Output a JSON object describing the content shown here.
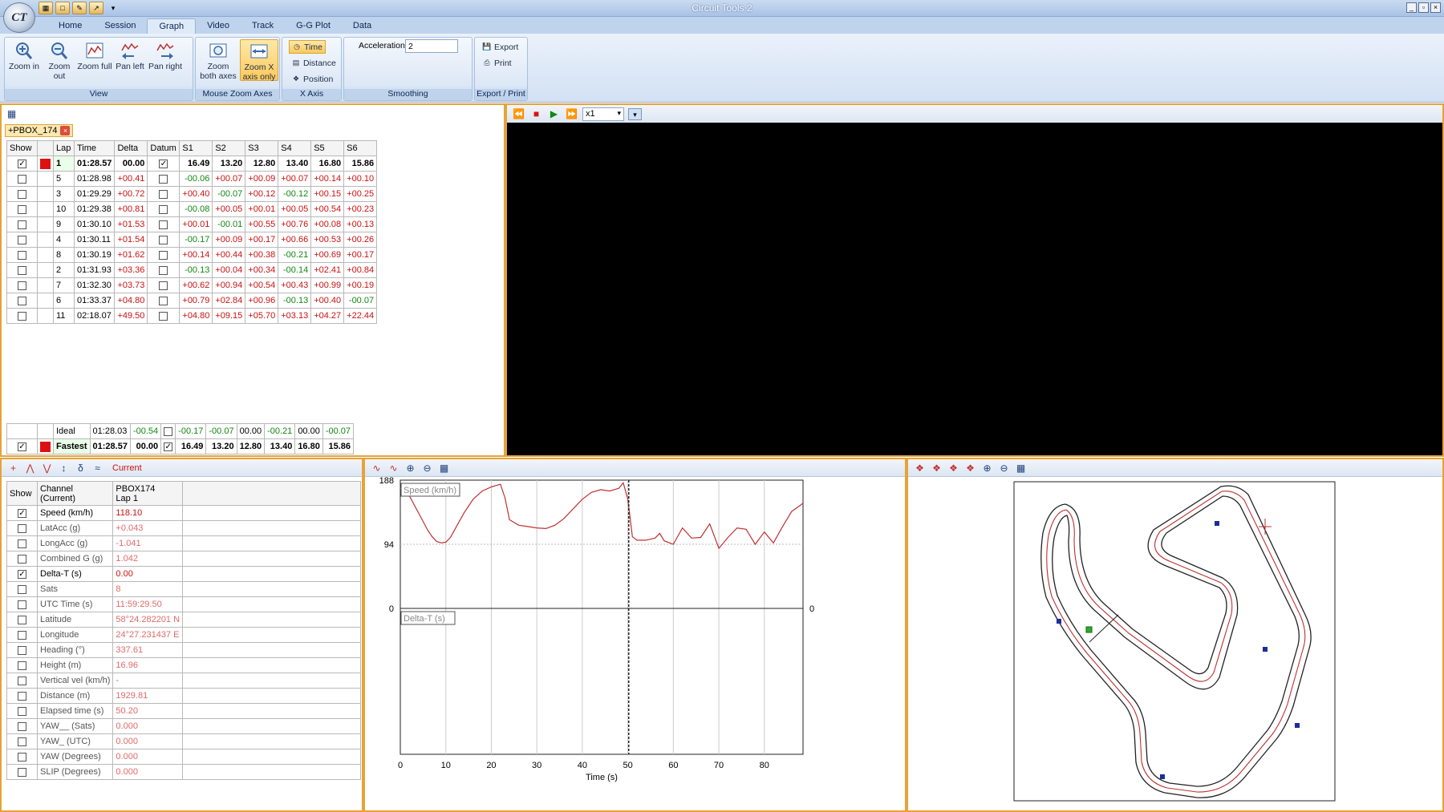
{
  "app": {
    "title": "Circuit Tools 2",
    "logo": "CT"
  },
  "tabs": [
    "Home",
    "Session",
    "Graph",
    "Video",
    "Track",
    "G-G Plot",
    "Data"
  ],
  "active_tab": "Graph",
  "ribbon": {
    "view": {
      "label": "View",
      "buttons": [
        {
          "label": "Zoom in",
          "icon": "zoom-in-icon"
        },
        {
          "label": "Zoom out",
          "icon": "zoom-out-icon"
        },
        {
          "label": "Zoom full",
          "icon": "zoom-full-icon"
        },
        {
          "label": "Pan left",
          "icon": "pan-left-icon"
        },
        {
          "label": "Pan right",
          "icon": "pan-right-icon"
        }
      ]
    },
    "mouse_zoom": {
      "label": "Mouse Zoom Axes",
      "buttons": [
        {
          "label": "Zoom both axes"
        },
        {
          "label": "Zoom X axis only",
          "selected": true
        }
      ]
    },
    "x_axis": {
      "label": "X Axis",
      "options": [
        "Time",
        "Distance",
        "Position"
      ],
      "selected": "Time"
    },
    "smoothing": {
      "label": "Smoothing",
      "field_label": "Acceleration",
      "value": "2"
    },
    "export": {
      "label": "Export / Print",
      "buttons": [
        "Export",
        "Print"
      ]
    }
  },
  "session_tab": "+PBOX_174",
  "laps": {
    "headers": [
      "Show",
      "",
      "Lap",
      "Time",
      "Delta",
      "Datum",
      "S1",
      "S2",
      "S3",
      "S4",
      "S5",
      "S6"
    ],
    "rows": [
      {
        "show": true,
        "color": "#dd1111",
        "lap": "1",
        "time": "01:28.57",
        "delta": "00.00",
        "datum": true,
        "s": [
          "16.49",
          "13.20",
          "12.80",
          "13.40",
          "16.80",
          "15.86"
        ],
        "bold": true
      },
      {
        "show": false,
        "lap": "5",
        "time": "01:28.98",
        "delta": "+00.41",
        "datum": false,
        "s": [
          "-00.06",
          "+00.07",
          "+00.09",
          "+00.07",
          "+00.14",
          "+00.10"
        ]
      },
      {
        "show": false,
        "lap": "3",
        "time": "01:29.29",
        "delta": "+00.72",
        "datum": false,
        "s": [
          "+00.40",
          "-00.07",
          "+00.12",
          "-00.12",
          "+00.15",
          "+00.25"
        ]
      },
      {
        "show": false,
        "lap": "10",
        "time": "01:29.38",
        "delta": "+00.81",
        "datum": false,
        "s": [
          "-00.08",
          "+00.05",
          "+00.01",
          "+00.05",
          "+00.54",
          "+00.23"
        ]
      },
      {
        "show": false,
        "lap": "9",
        "time": "01:30.10",
        "delta": "+01.53",
        "datum": false,
        "s": [
          "+00.01",
          "-00.01",
          "+00.55",
          "+00.76",
          "+00.08",
          "+00.13"
        ]
      },
      {
        "show": false,
        "lap": "4",
        "time": "01:30.11",
        "delta": "+01.54",
        "datum": false,
        "s": [
          "-00.17",
          "+00.09",
          "+00.17",
          "+00.66",
          "+00.53",
          "+00.26"
        ]
      },
      {
        "show": false,
        "lap": "8",
        "time": "01:30.19",
        "delta": "+01.62",
        "datum": false,
        "s": [
          "+00.14",
          "+00.44",
          "+00.38",
          "-00.21",
          "+00.69",
          "+00.17"
        ]
      },
      {
        "show": false,
        "lap": "2",
        "time": "01:31.93",
        "delta": "+03.36",
        "datum": false,
        "s": [
          "-00.13",
          "+00.04",
          "+00.34",
          "-00.14",
          "+02.41",
          "+00.84"
        ]
      },
      {
        "show": false,
        "lap": "7",
        "time": "01:32.30",
        "delta": "+03.73",
        "datum": false,
        "s": [
          "+00.62",
          "+00.94",
          "+00.54",
          "+00.43",
          "+00.99",
          "+00.19"
        ]
      },
      {
        "show": false,
        "lap": "6",
        "time": "01:33.37",
        "delta": "+04.80",
        "datum": false,
        "s": [
          "+00.79",
          "+02.84",
          "+00.96",
          "-00.13",
          "+00.40",
          "-00.07"
        ]
      },
      {
        "show": false,
        "lap": "11",
        "time": "02:18.07",
        "delta": "+49.50",
        "datum": false,
        "s": [
          "+04.80",
          "+09.15",
          "+05.70",
          "+03.13",
          "+04.27",
          "+22.44"
        ]
      }
    ],
    "summary": [
      {
        "show": null,
        "lap": "Ideal",
        "time": "01:28.03",
        "delta": "-00.54",
        "datum": false,
        "s": [
          "-00.17",
          "-00.07",
          "00.00",
          "-00.21",
          "00.00",
          "-00.07"
        ]
      },
      {
        "show": true,
        "color": "#dd1111",
        "lap": "Fastest",
        "time": "01:28.57",
        "delta": "00.00",
        "datum": true,
        "s": [
          "16.49",
          "13.20",
          "12.80",
          "13.40",
          "16.80",
          "15.86"
        ],
        "bold": true
      }
    ]
  },
  "video": {
    "speed": "x1"
  },
  "channels": {
    "toolbar_label": "Current",
    "headers": [
      "Show",
      "Channel (Current)",
      "PBOX174 Lap 1"
    ],
    "header_channel": [
      "Channel",
      "(Current)"
    ],
    "header_session": [
      "PBOX174",
      "Lap 1"
    ],
    "rows": [
      {
        "show": true,
        "name": "Speed (km/h)",
        "value": "118.10"
      },
      {
        "show": false,
        "name": "LatAcc (g)",
        "value": "+0.043"
      },
      {
        "show": false,
        "name": "LongAcc (g)",
        "value": "-1.041"
      },
      {
        "show": false,
        "name": "Combined G (g)",
        "value": "1.042"
      },
      {
        "show": true,
        "name": "Delta-T (s)",
        "value": "0.00"
      },
      {
        "show": false,
        "name": "Sats",
        "value": "8"
      },
      {
        "show": false,
        "name": "UTC Time (s)",
        "value": "11:59:29.50"
      },
      {
        "show": false,
        "name": "Latitude",
        "value": "58°24.282201 N"
      },
      {
        "show": false,
        "name": "Longitude",
        "value": "24°27.231437 E"
      },
      {
        "show": false,
        "name": "Heading (°)",
        "value": "337.61"
      },
      {
        "show": false,
        "name": "Height (m)",
        "value": "16.96"
      },
      {
        "show": false,
        "name": "Vertical vel (km/h)",
        "value": "-"
      },
      {
        "show": false,
        "name": "Distance (m)",
        "value": "1929.81"
      },
      {
        "show": false,
        "name": "Elapsed time (s)",
        "value": "50.20"
      },
      {
        "show": false,
        "name": "YAW__ (Sats)",
        "value": "0.000"
      },
      {
        "show": false,
        "name": "YAW_ (UTC)",
        "value": "0.000"
      },
      {
        "show": false,
        "name": "YAW (Degrees)",
        "value": "0.000"
      },
      {
        "show": false,
        "name": "SLIP (Degrees)",
        "value": "0.000"
      }
    ]
  },
  "graph": {
    "chart_data": {
      "type": "line",
      "xlabel": "Time (s)",
      "x_ticks": [
        0,
        10,
        20,
        30,
        40,
        50,
        60,
        70,
        80
      ],
      "xlim": [
        0,
        88.5
      ],
      "cursor_x": 50.2,
      "series": [
        {
          "name": "Speed (km/h)",
          "color": "#c03030",
          "ylim": [
            0,
            188
          ],
          "y_ticks": [
            188,
            94,
            0
          ],
          "x": [
            0,
            2,
            4,
            6,
            7,
            8,
            9,
            10,
            11,
            12,
            14,
            16,
            18,
            20,
            21,
            22,
            23,
            24,
            26,
            28,
            30,
            32,
            34,
            36,
            38,
            40,
            42,
            44,
            46,
            48,
            49,
            50,
            51,
            52,
            54,
            56,
            57,
            58,
            60,
            62,
            64,
            66,
            68,
            70,
            72,
            74,
            76,
            78,
            80,
            82,
            84,
            86,
            88.5
          ],
          "y": [
            176,
            165,
            140,
            115,
            105,
            98,
            96,
            97,
            104,
            116,
            140,
            160,
            172,
            178,
            180,
            182,
            162,
            130,
            122,
            120,
            118,
            117,
            122,
            132,
            146,
            160,
            170,
            174,
            172,
            176,
            184,
            160,
            105,
            100,
            100,
            103,
            110,
            99,
            94,
            118,
            103,
            104,
            124,
            88,
            104,
            118,
            116,
            94,
            112,
            96,
            120,
            142,
            154
          ]
        },
        {
          "name": "Delta-T (s)",
          "color": "#c03030",
          "y_ticks": [
            0
          ],
          "x": [
            0,
            88.5
          ],
          "y": [
            0,
            0
          ]
        }
      ]
    }
  },
  "track": {
    "path_color": "#c03030"
  }
}
